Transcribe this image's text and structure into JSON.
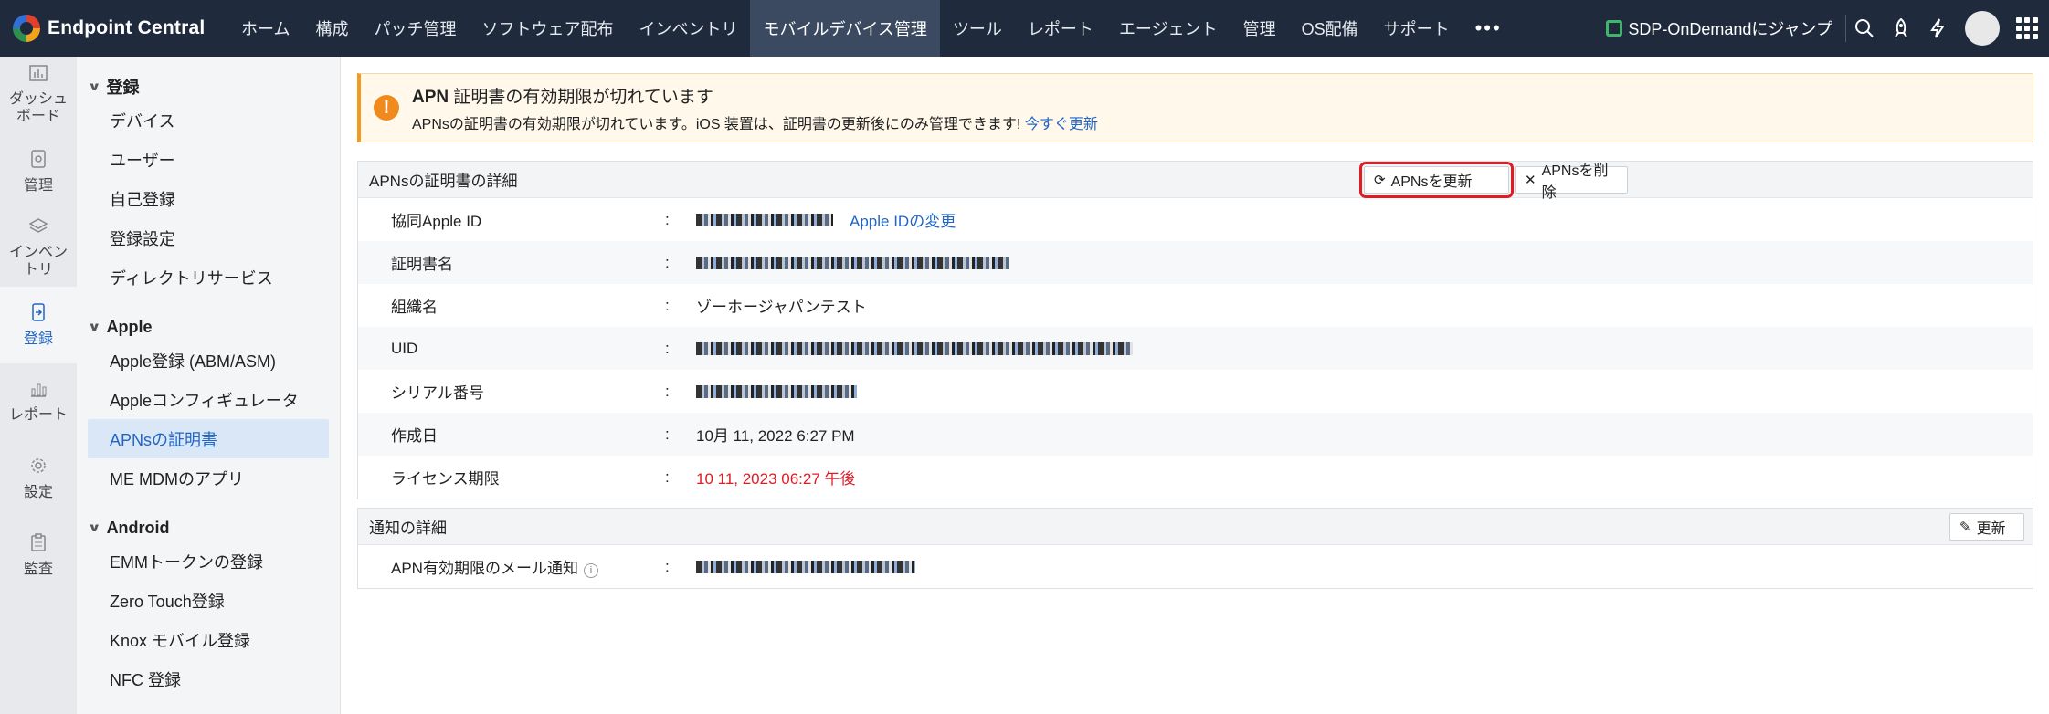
{
  "brand": {
    "name": "Endpoint Central"
  },
  "nav": {
    "items": [
      "ホーム",
      "構成",
      "パッチ管理",
      "ソフトウェア配布",
      "インベントリ",
      "モバイルデバイス管理",
      "ツール",
      "レポート",
      "エージェント",
      "管理",
      "OS配備",
      "サポート"
    ],
    "more": "•••"
  },
  "topright": {
    "jump_label": "SDP-OnDemandにジャンプ"
  },
  "rail": {
    "dashboard": "ダッシュボード",
    "manage": "管理",
    "inventory": "インベントリ",
    "enroll": "登録",
    "report": "レポート",
    "settings": "設定",
    "audit": "監査"
  },
  "submenu": {
    "sec_enroll": "登録",
    "devices": "デバイス",
    "users": "ユーザー",
    "self_enroll": "自己登録",
    "enroll_settings": "登録設定",
    "directory": "ディレクトリサービス",
    "sec_apple": "Apple",
    "apple_abm": "Apple登録 (ABM/ASM)",
    "apple_configurator": "Appleコンフィギュレータ",
    "apns_cert": "APNsの証明書",
    "me_mdm_app": "ME MDMのアプリ",
    "sec_android": "Android",
    "emm_token": "EMMトークンの登録",
    "zero_touch": "Zero Touch登録",
    "knox": "Knox モバイル登録",
    "nfc": "NFC 登録"
  },
  "alert": {
    "title_prefix": "APN",
    "title_rest": " 証明書の有効期限が切れています",
    "text": "APNsの証明書の有効期限が切れています。iOS 装置は、証明書の更新後にのみ管理できます! ",
    "link": "今すぐ更新"
  },
  "cert_panel": {
    "title": "APNsの証明書の詳細",
    "renew_button": "APNsを更新",
    "delete_button": "APNsを削除",
    "rows": {
      "apple_id_label": "協同Apple ID",
      "apple_id_link": "Apple IDの変更",
      "cert_name_label": "証明書名",
      "org_label": "組織名",
      "org_value": "ゾーホージャパンテスト",
      "uid_label": "UID",
      "serial_label": "シリアル番号",
      "created_label": "作成日",
      "created_value": "10月 11, 2022 6:27 PM",
      "expiry_label": "ライセンス期限",
      "expiry_value": "10 11, 2023 06:27 午後"
    },
    "colon": ":"
  },
  "notify_panel": {
    "title": "通知の詳細",
    "update_button": "更新",
    "email_label": "APN有効期限のメール通知"
  },
  "colors": {
    "nav_bg": "#1f2b3d",
    "accent": "#2166c5",
    "alert": "#f08a1c",
    "error": "#e01b24"
  }
}
